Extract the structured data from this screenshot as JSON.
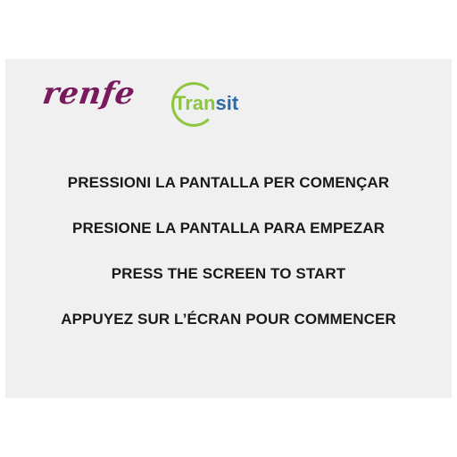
{
  "brand": {
    "renfe_logo_text": "renfe",
    "transit_logo_part1": "Tran",
    "transit_logo_part2": "sit"
  },
  "colors": {
    "renfe": "#7a1a5e",
    "transit_green": "#8cc63f",
    "transit_blue": "#2b6aa5",
    "screen_background": "#f0f0f0",
    "text": "#1a1a1a"
  },
  "messages": [
    "PRESSIONI LA PANTALLA PER COMENÇAR",
    "PRESIONE LA PANTALLA PARA EMPEZAR",
    "PRESS THE SCREEN TO START",
    "APPUYEZ SUR L’ÉCRAN POUR COMMENCER"
  ]
}
